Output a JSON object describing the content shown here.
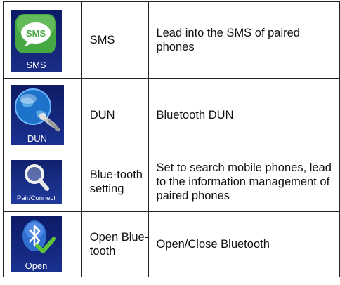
{
  "rows": [
    {
      "icon": "sms-icon",
      "tile_label": "SMS",
      "name": "SMS",
      "description": "Lead into the SMS of paired phones"
    },
    {
      "icon": "dun-globe-icon",
      "tile_label": "DUN",
      "name": "DUN",
      "description": "Bluetooth DUN"
    },
    {
      "icon": "search-magnifier-icon",
      "tile_label": "Pair/Connect",
      "name": "Blue-tooth setting",
      "description": "Set to search mobile phones, lead to the information management of paired phones"
    },
    {
      "icon": "bluetooth-check-icon",
      "tile_label": "Open",
      "name": "Open Blue-tooth",
      "description": "Open/Close Bluetooth"
    }
  ],
  "colors": {
    "tile_bg": "#0f1e6a",
    "sms_green": "#4fb04a",
    "check_green": "#5dc43a"
  }
}
